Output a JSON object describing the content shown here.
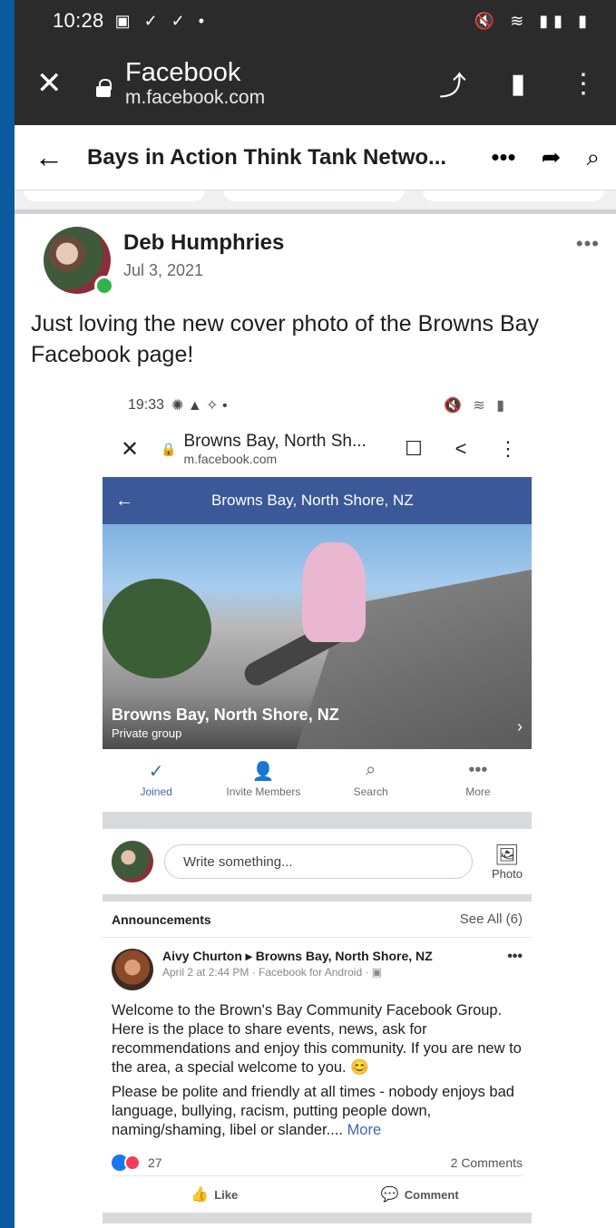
{
  "status_bar": {
    "time": "10:28",
    "notif_icons": "▣ ✓ ✓ •",
    "right_icons": "🔇 ≋ ▮▮ ▮"
  },
  "chrome": {
    "close_icon": "✕",
    "title": "Facebook",
    "url": "m.facebook.com",
    "share_icon": "⤴",
    "bookmark_icon": "▮",
    "menu_icon": "⋮"
  },
  "fb_bar": {
    "back_icon": "←",
    "group_name": "Bays in Action Think Tank Netwo...",
    "more_icon": "•••",
    "share_icon": "➦",
    "search_icon": "⌕"
  },
  "post": {
    "author": "Deb Humphries",
    "date": "Jul 3, 2021",
    "more_icon": "•••",
    "text": "Just loving the new cover photo of the Browns Bay Facebook page!"
  },
  "shot": {
    "status": {
      "time": "19:33",
      "icons": "✺ ▲ ✧ •",
      "right": "🔇 ≋ ▮"
    },
    "chrome": {
      "close": "✕",
      "lock": "🔒",
      "title": "Browns Bay, North Sh...",
      "url": "m.facebook.com",
      "bookmark": "☐",
      "share": "<",
      "menu": "⋮"
    },
    "header": {
      "back": "←",
      "title": "Browns Bay, North Shore, NZ"
    },
    "cover": {
      "group_name": "Browns Bay, North Shore, NZ",
      "privacy": "Private group",
      "arrow": "›"
    },
    "tabs": [
      {
        "icon": "✓",
        "label": "Joined"
      },
      {
        "icon": "👤",
        "label": "Invite Members"
      },
      {
        "icon": "⌕",
        "label": "Search"
      },
      {
        "icon": "•••",
        "label": "More"
      }
    ],
    "composer": {
      "placeholder": "Write something...",
      "photo_icon": "🖼",
      "photo_label": "Photo"
    },
    "announcements": {
      "heading": "Announcements",
      "see_all": "See All (6)"
    },
    "inner_post": {
      "author_line": "Aivy Churton ▸ Browns Bay, North Shore, NZ",
      "meta": "April 2 at 2:44 PM · Facebook for Android · ▣",
      "more": "•••",
      "para1": "Welcome to the Brown's Bay Community Facebook Group. Here is the place to share events, news, ask for recommendations and enjoy this community. If you are new to the area, a special welcome to you. 😊",
      "para2": "Please be polite and friendly at all times - nobody enjoys bad language, bullying, racism, putting people down, naming/shaming, libel or slander....",
      "more_link": "More",
      "reactions_count": "27",
      "comments": "2 Comments",
      "like_label": "Like",
      "comment_label": "Comment",
      "like_icon": "👍",
      "comment_icon": "💬"
    }
  }
}
